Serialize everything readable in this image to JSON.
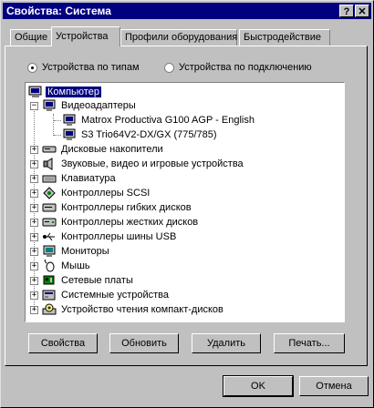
{
  "window": {
    "title": "Свойства: Система",
    "help_btn": "?",
    "close_btn": "✕"
  },
  "tabs": [
    {
      "label": "Общие"
    },
    {
      "label": "Устройства"
    },
    {
      "label": "Профили оборудования"
    },
    {
      "label": "Быстродействие"
    }
  ],
  "view_options": {
    "by_type": "Устройства по типам",
    "by_connection": "Устройства по подключению"
  },
  "tree": {
    "root": "Компьютер",
    "items": [
      {
        "label": "Видеоадаптеры",
        "icon": "monitor-icon",
        "expanded": "−"
      },
      {
        "label": "Matrox Productiva G100 AGP - English",
        "icon": "monitor-icon"
      },
      {
        "label": "S3 Trio64V2-DX/GX (775/785)",
        "icon": "monitor-icon"
      },
      {
        "label": "Дисковые накопители",
        "icon": "disk-drive-icon",
        "expanded": "+"
      },
      {
        "label": "Звуковые, видео и игровые устройства",
        "icon": "speaker-icon",
        "expanded": "+"
      },
      {
        "label": "Клавиатура",
        "icon": "keyboard-icon",
        "expanded": "+"
      },
      {
        "label": "Контроллеры SCSI",
        "icon": "scsi-icon",
        "expanded": "+"
      },
      {
        "label": "Контроллеры гибких дисков",
        "icon": "floppy-controller-icon",
        "expanded": "+"
      },
      {
        "label": "Контроллеры жестких дисков",
        "icon": "hdd-controller-icon",
        "expanded": "+"
      },
      {
        "label": "Контроллеры шины USB",
        "icon": "usb-icon",
        "expanded": "+"
      },
      {
        "label": "Мониторы",
        "icon": "monitor-icon",
        "expanded": "+"
      },
      {
        "label": "Мышь",
        "icon": "mouse-icon",
        "expanded": "+"
      },
      {
        "label": "Сетевые платы",
        "icon": "network-card-icon",
        "expanded": "+"
      },
      {
        "label": "Системные устройства",
        "icon": "system-device-icon",
        "expanded": "+"
      },
      {
        "label": "Устройство чтения компакт-дисков",
        "icon": "cdrom-icon",
        "expanded": "+"
      }
    ]
  },
  "buttons": {
    "properties": "Свойства",
    "refresh": "Обновить",
    "remove": "Удалить",
    "print": "Печать..."
  },
  "dialog": {
    "ok": "OK",
    "cancel": "Отмена"
  }
}
